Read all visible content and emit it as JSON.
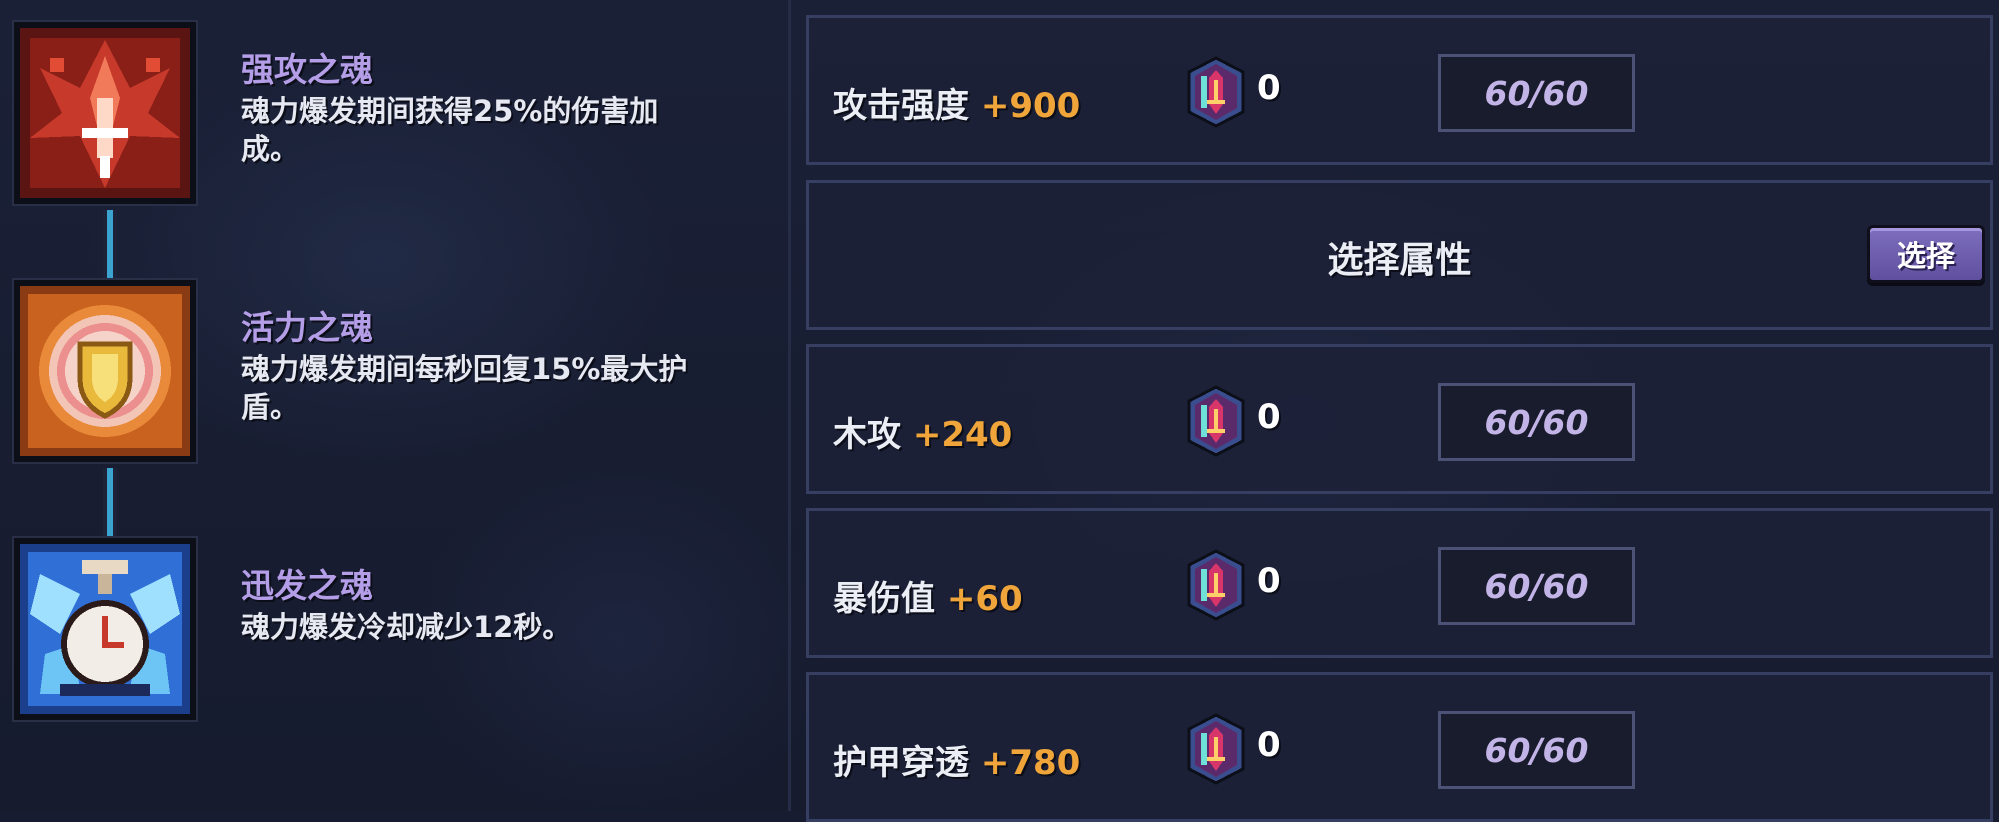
{
  "souls": [
    {
      "name": "强攻之魂",
      "desc_line1": "魂力爆发期间获得25%的伤害加",
      "desc_line2": "成。",
      "icon": "red-claw-soul-icon"
    },
    {
      "name": "活力之魂",
      "desc_line1": "魂力爆发期间每秒回复15%最大护",
      "desc_line2": "盾。",
      "icon": "golden-shield-soul-icon"
    },
    {
      "name": "迅发之魂",
      "desc_line1": "魂力爆发冷却减少12秒。",
      "desc_line2": "",
      "icon": "blue-clock-soul-icon"
    }
  ],
  "slots": [
    {
      "type": "stat",
      "stat": "攻击强度",
      "bonus": "+900",
      "gem_count": "0",
      "level": "60/60"
    },
    {
      "type": "select",
      "title": "选择属性",
      "button": "选择"
    },
    {
      "type": "stat",
      "stat": "木攻",
      "bonus": "+240",
      "gem_count": "0",
      "level": "60/60"
    },
    {
      "type": "stat",
      "stat": "暴伤值",
      "bonus": "+60",
      "gem_count": "0",
      "level": "60/60"
    },
    {
      "type": "stat",
      "stat": "护甲穿透",
      "bonus": "+780",
      "gem_count": "0",
      "level": "60/60"
    }
  ],
  "colors": {
    "soul_name": "#b59ee8",
    "bonus": "#f0a53a",
    "level_text": "#c2b4e6",
    "button": "#6e5fae",
    "connector": "#3aa3cf"
  },
  "icons": {
    "gem": "crystal-sword-gem-icon"
  }
}
